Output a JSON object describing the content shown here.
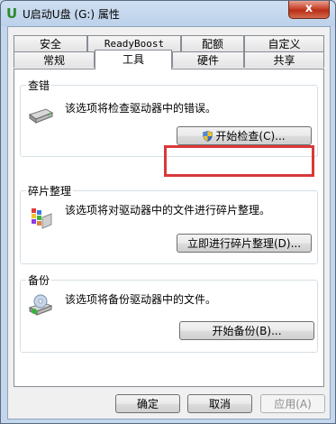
{
  "window": {
    "title": "U启动U盘 (G:) 属性",
    "close_glyph": "x"
  },
  "tabs": {
    "row1": [
      "安全",
      "ReadyBoost",
      "配额",
      "自定义"
    ],
    "row2": [
      "常规",
      "工具",
      "硬件",
      "共享"
    ],
    "active": "工具"
  },
  "groups": {
    "check": {
      "title": "查错",
      "desc": "该选项将检查驱动器中的错误。",
      "button": "开始检查(C)..."
    },
    "defrag": {
      "title": "碎片整理",
      "desc": "该选项将对驱动器中的文件进行碎片整理。",
      "button": "立即进行碎片整理(D)..."
    },
    "backup": {
      "title": "备份",
      "desc": "该选项将备份驱动器中的文件。",
      "button": "开始备份(B)..."
    }
  },
  "footer": {
    "ok": "确定",
    "cancel": "取消",
    "apply": "应用(A)"
  },
  "colors": {
    "highlight": "#d9393a",
    "close": "#c7442b"
  }
}
